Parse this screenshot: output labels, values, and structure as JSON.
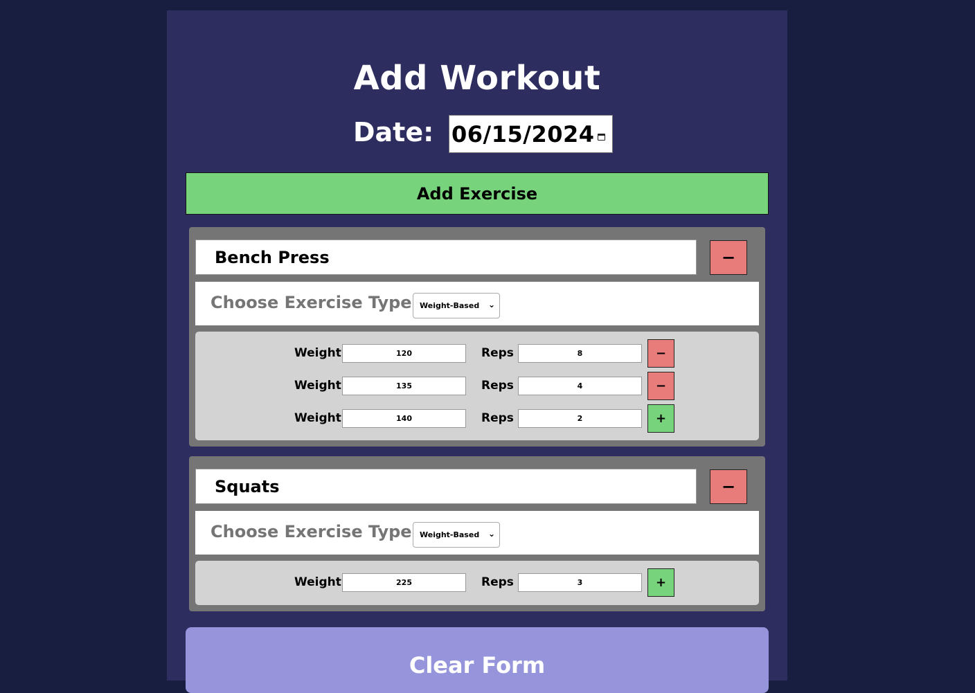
{
  "page": {
    "title": "Add Workout"
  },
  "date": {
    "label": "Date:",
    "value": "06/15/2024"
  },
  "buttons": {
    "add_exercise": "Add Exercise",
    "clear_form": "Clear Form",
    "remove_symbol": "−",
    "add_symbol": "+"
  },
  "labels": {
    "choose_type": "Choose Exercise Type:",
    "weight": "Weight",
    "reps": "Reps"
  },
  "exercises": [
    {
      "name": "Bench Press",
      "type": "Weight-Based",
      "sets": [
        {
          "weight": "120",
          "reps": "8"
        },
        {
          "weight": "135",
          "reps": "4"
        },
        {
          "weight": "140",
          "reps": "2"
        }
      ]
    },
    {
      "name": "Squats",
      "type": "Weight-Based",
      "sets": [
        {
          "weight": "225",
          "reps": "3"
        }
      ]
    }
  ],
  "colors": {
    "background": "#171e40",
    "panel": "#2e2d5f",
    "add_green": "#78d47c",
    "remove_red": "#e77c7b",
    "clear_purple": "#9695dc"
  }
}
